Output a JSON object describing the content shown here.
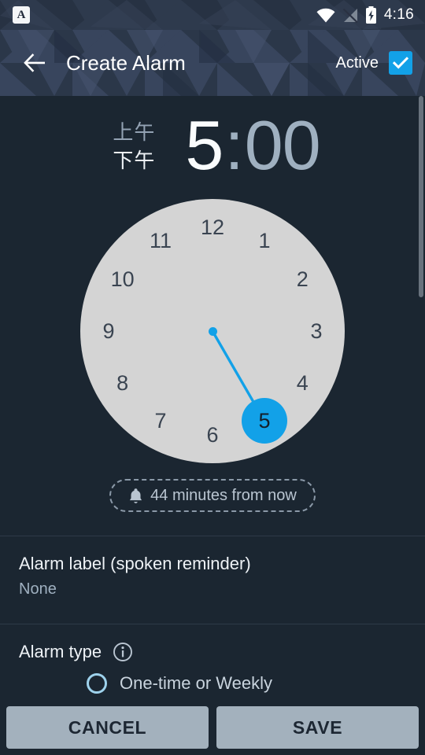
{
  "status_bar": {
    "app_icon_letter": "A",
    "time": "4:16",
    "icons": [
      "wifi-icon",
      "no-signal-icon",
      "battery-charging-icon"
    ]
  },
  "app_bar": {
    "back_icon": "back-arrow-icon",
    "title": "Create Alarm",
    "active_label": "Active",
    "active_checked": true,
    "check_icon": "check-icon",
    "accent": "#12a1e8"
  },
  "time_picker": {
    "am_label": "上午",
    "pm_label": "下午",
    "selected_period": "下午",
    "hour": "5",
    "colon": ":",
    "minute": "00",
    "selected_field": "hour"
  },
  "clock": {
    "numbers": [
      "12",
      "1",
      "2",
      "3",
      "4",
      "5",
      "6",
      "7",
      "8",
      "9",
      "10",
      "11"
    ],
    "selected": "5",
    "face_color": "#d4d4d4",
    "hand_color": "#12a1e8",
    "number_color": "#3a4451"
  },
  "chip": {
    "icon": "bell-icon",
    "text": "44 minutes from now"
  },
  "alarm_label_row": {
    "title": "Alarm label (spoken reminder)",
    "value": "None"
  },
  "alarm_type_row": {
    "title": "Alarm type",
    "info_icon": "info-icon",
    "option_label": "One-time or Weekly",
    "option_selected": false
  },
  "buttons": {
    "cancel": "CANCEL",
    "save": "SAVE"
  }
}
